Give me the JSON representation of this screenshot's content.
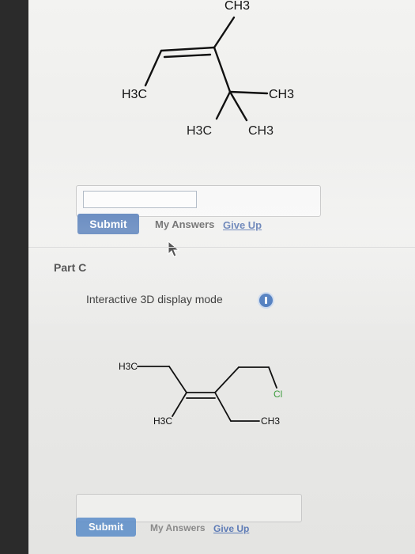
{
  "part_a": {
    "molecule": {
      "top_label": "CH3",
      "left_label": "H3C",
      "right_label": "CH3",
      "bottom_left_label": "H3C",
      "bottom_right_label": "CH3"
    },
    "submit_label": "Submit",
    "my_answers_label": "My Answers",
    "give_up_label": "Give Up"
  },
  "part_c": {
    "title": "Part C",
    "mode_label": "Interactive 3D display mode",
    "info_icon": "info-icon",
    "molecule": {
      "top_left_label": "H3C",
      "bottom_left_label": "H3C",
      "right_label": "CH3",
      "cl_label": "Cl"
    },
    "submit_label": "Submit",
    "my_answers_label": "My Answers",
    "give_up_label": "Give Up"
  },
  "colors": {
    "submit": "#2d5ea8",
    "link": "#2a4f9a",
    "info": "#3d6fb8",
    "chlorine": "#3e9c3e"
  }
}
